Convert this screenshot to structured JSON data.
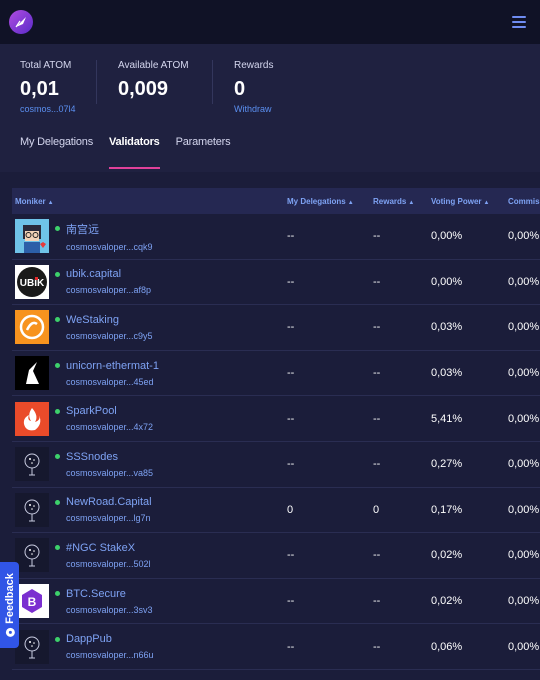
{
  "colors": {
    "accent": "#e0419a",
    "link": "#7ea2f3",
    "status_online": "#3dd16b",
    "feedback": "#3155e6"
  },
  "stats": [
    {
      "label": "Total ATOM",
      "value": "0,01",
      "sub": "cosmos...07l4"
    },
    {
      "label": "Available ATOM",
      "value": "0,009",
      "sub": ""
    },
    {
      "label": "Rewards",
      "value": "0",
      "sub": "Withdraw"
    }
  ],
  "tabs": [
    {
      "label": "My Delegations",
      "active": false
    },
    {
      "label": "Validators",
      "active": true
    },
    {
      "label": "Parameters",
      "active": false
    }
  ],
  "table": {
    "headers": {
      "moniker": "Moniker",
      "delegations": "My Delegations",
      "rewards": "Rewards",
      "voting_power": "Voting Power",
      "commission": "Commis"
    },
    "rows": [
      {
        "name": "南宫远",
        "address": "cosmosvaloper...cqk9",
        "delegations": "--",
        "rewards": "--",
        "voting_power": "0,00%",
        "commission": "0,00%",
        "icon": "anime-avatar-icon"
      },
      {
        "name": "ubik.capital",
        "address": "cosmosvaloper...af8p",
        "delegations": "--",
        "rewards": "--",
        "voting_power": "0,00%",
        "commission": "0,00%",
        "icon": "ubik-logo-icon"
      },
      {
        "name": "WeStaking",
        "address": "cosmosvaloper...c9y5",
        "delegations": "--",
        "rewards": "--",
        "voting_power": "0,03%",
        "commission": "0,00%",
        "icon": "westaking-logo-icon"
      },
      {
        "name": "unicorn-ethermat-1",
        "address": "cosmosvaloper...45ed",
        "delegations": "--",
        "rewards": "--",
        "voting_power": "0,03%",
        "commission": "0,00%",
        "icon": "unicorn-logo-icon"
      },
      {
        "name": "SparkPool",
        "address": "cosmosvaloper...4x72",
        "delegations": "--",
        "rewards": "--",
        "voting_power": "5,41%",
        "commission": "0,00%",
        "icon": "flame-logo-icon"
      },
      {
        "name": "SSSnodes",
        "address": "cosmosvaloper...va85",
        "delegations": "--",
        "rewards": "--",
        "voting_power": "0,27%",
        "commission": "0,00%",
        "icon": "default-validator-icon"
      },
      {
        "name": "NewRoad.Capital",
        "address": "cosmosvaloper...lg7n",
        "delegations": "0",
        "rewards": "0",
        "voting_power": "0,17%",
        "commission": "0,00%",
        "icon": "default-validator-icon"
      },
      {
        "name": "#NGC StakeX",
        "address": "cosmosvaloper...502l",
        "delegations": "--",
        "rewards": "--",
        "voting_power": "0,02%",
        "commission": "0,00%",
        "icon": "default-validator-icon"
      },
      {
        "name": "BTC.Secure",
        "address": "cosmosvaloper...3sv3",
        "delegations": "--",
        "rewards": "--",
        "voting_power": "0,02%",
        "commission": "0,00%",
        "icon": "btc-secure-logo-icon"
      },
      {
        "name": "DappPub",
        "address": "cosmosvaloper...n66u",
        "delegations": "--",
        "rewards": "--",
        "voting_power": "0,06%",
        "commission": "0,00%",
        "icon": "default-validator-icon"
      }
    ]
  },
  "feedback": {
    "label": "Feedback"
  }
}
